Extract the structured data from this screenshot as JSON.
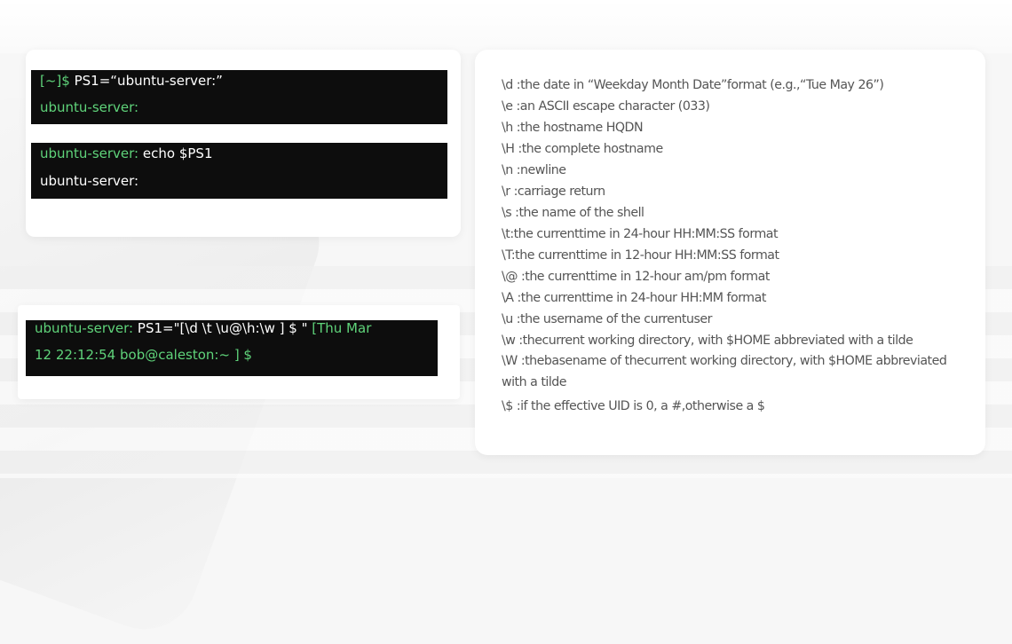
{
  "terminal_1": {
    "line1": {
      "prompt": "[~]$",
      "command": "PS1=“ubuntu-server:”"
    },
    "line2": {
      "prompt": "ubuntu-server:"
    }
  },
  "terminal_2": {
    "line1": {
      "prompt": "ubuntu-server:",
      "command": "echo $PS1"
    },
    "line2": {
      "text": "ubuntu-server:"
    }
  },
  "terminal_3": {
    "line1": {
      "prompt": "ubuntu-server:",
      "command": "PS1=\"[\\d \\t \\u@\\h:\\w ] $ \"",
      "output": "[Thu Mar"
    },
    "line2": {
      "output": "12 22:12:54 bob@caleston:~ ] $"
    }
  },
  "reference": [
    "\\d :the date in “Weekday Month Date”format (e.g.,“Tue May 26”)",
    "\\e :an ASCII escape character (033)",
    "\\h :the hostname HQDN",
    "\\H :the complete hostname",
    "\\n :newline",
    "\\r :carriage return",
    "\\s :the name of the shell",
    "\\t:the currenttime in 24-hour HH:MM:SS format",
    "\\T:the currenttime in 12-hour HH:MM:SS format",
    "\\@ :the currenttime in 12-hour am/pm format",
    "\\A :the currenttime in 24-hour HH:MM format",
    "\\u :the username of the currentuser",
    "\\w :thecurrent working directory, with $HOME abbreviated with a tilde",
    "\\W :thebasename of thecurrent working directory, with $HOME abbreviated with a tilde",
    "\\$ :if the effective UID is 0, a #,otherwise a $"
  ],
  "colors": {
    "terminal_bg": "#0d0d0d",
    "prompt_green": "#5fd37a",
    "text_gray": "#555555"
  }
}
